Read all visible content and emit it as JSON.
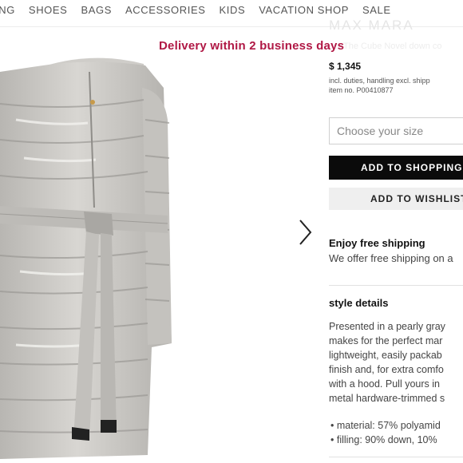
{
  "nav": {
    "items": [
      "ING",
      "SHOES",
      "BAGS",
      "ACCESSORIES",
      "KIDS",
      "VACATION SHOP",
      "SALE"
    ]
  },
  "banner": {
    "delivery": "Delivery within 2 business days"
  },
  "product": {
    "brand": "MAX MARA",
    "subtitle": "The Cube Novel down co",
    "price": "$ 1,345",
    "duties": "incl. duties, handling excl. shipp",
    "item_no": "item no. P00410877",
    "size_placeholder": "Choose your size",
    "add_to_bag": "ADD TO SHOPPING",
    "add_to_wishlist": "ADD TO WISHLIST"
  },
  "shipping": {
    "title": "Enjoy free shipping",
    "text": "We offer free shipping on a"
  },
  "style_details": {
    "title": "style details",
    "lines": [
      "Presented in a pearly gray",
      "makes for the perfect mar",
      "lightweight, easily packab",
      "finish and, for extra comfo",
      "with a hood. Pull yours in",
      "metal hardware-trimmed s"
    ],
    "bullets": [
      "•  material: 57% polyamid",
      "•  filling: 90% down, 10%"
    ]
  },
  "colors": {
    "accent": "#b01845",
    "button_dark": "#0b0b0b",
    "coat": "#c9c7c3"
  },
  "icons": {
    "next": "chevron-right-icon"
  }
}
